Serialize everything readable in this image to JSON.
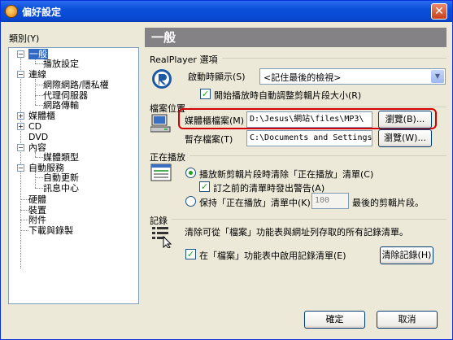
{
  "window": {
    "title": "偏好設定"
  },
  "category": {
    "label": "類別(Y)",
    "items": [
      {
        "label": "一般"
      },
      {
        "label": "播放設定"
      },
      {
        "label": "連線"
      },
      {
        "label": "網際網路/隱私權"
      },
      {
        "label": "代理伺服器"
      },
      {
        "label": "網路傳輸"
      },
      {
        "label": "媒體櫃"
      },
      {
        "label": "CD"
      },
      {
        "label": "DVD"
      },
      {
        "label": "內容"
      },
      {
        "label": "媒體類型"
      },
      {
        "label": "自動服務"
      },
      {
        "label": "自動更新"
      },
      {
        "label": "訊息中心"
      },
      {
        "label": "硬體"
      },
      {
        "label": "裝置"
      },
      {
        "label": "附件"
      },
      {
        "label": "下載與錄製"
      }
    ]
  },
  "panel": {
    "header": "一般",
    "realplayer": {
      "group_label": "RealPlayer 選項",
      "startup_label": "啟動時顯示(S)",
      "startup_value": "<記住最後的檢視>",
      "auto_resize_label": "開始播放時自動調整剪輯片段大小(R)"
    },
    "file_locations": {
      "group_label": "檔案位置",
      "media_library_label": "媒體櫃檔案(M)",
      "media_library_path": "D:\\Jesus\\網站\\files\\MP3\\",
      "temp_files_label": "暫存檔案(T)",
      "temp_files_path": "C:\\Documents and Settings\\pe",
      "browse_label_1": "瀏覽(B)...",
      "browse_label_2": "瀏覽(W)..."
    },
    "now_playing": {
      "group_label": "正在播放",
      "option_clear": "播放新剪輯片段時清除「正在播放」清單(C)",
      "option_warn": "訂之前的清單時發出警告(A)",
      "option_keep_prefix": "保持「正在播放」清單中(K)",
      "keep_count": "100",
      "option_keep_suffix": "最後的剪輯片段。"
    },
    "history": {
      "group_label": "記錄",
      "description": "清除可從「檔案」功能表與網址列存取的所有記錄清單。",
      "enable_label": "在「檔案」功能表中啟用記錄清單(E)",
      "clear_button": "清除記錄(H)"
    }
  },
  "footer": {
    "ok_label": "確定",
    "cancel_label": "取消"
  }
}
